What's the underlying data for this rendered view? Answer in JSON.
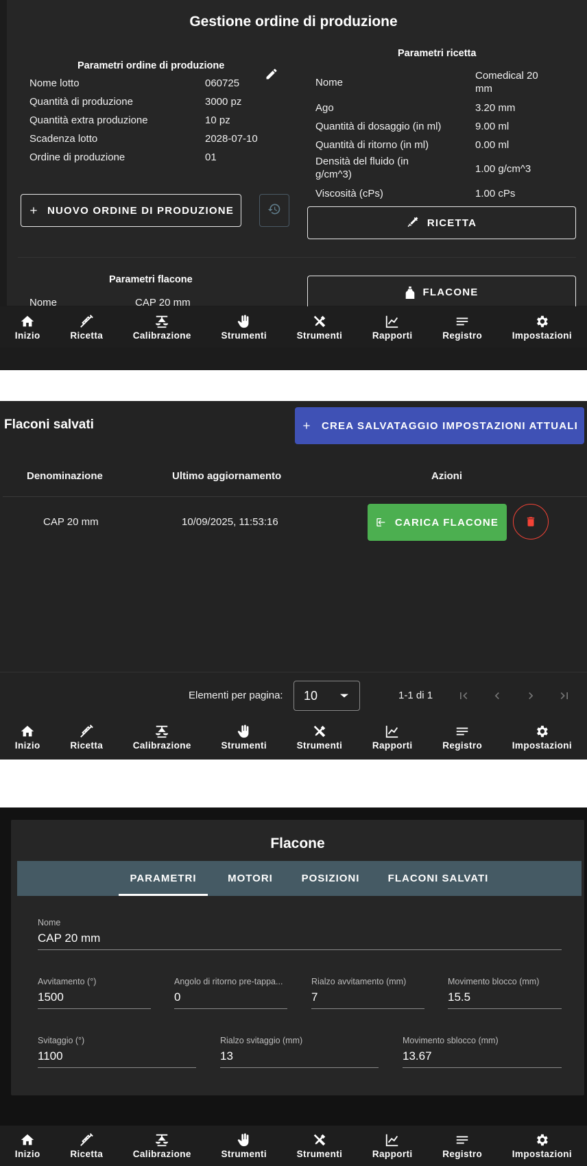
{
  "nav_items": [
    {
      "label": "Inizio",
      "icon": "home-icon"
    },
    {
      "label": "Ricetta",
      "icon": "syringe-icon"
    },
    {
      "label": "Calibrazione",
      "icon": "scale-icon"
    },
    {
      "label": "Strumenti",
      "icon": "hand-icon"
    },
    {
      "label": "Strumenti",
      "icon": "tools-icon"
    },
    {
      "label": "Rapporti",
      "icon": "chart-icon"
    },
    {
      "label": "Registro",
      "icon": "list-icon"
    },
    {
      "label": "Impostazioni",
      "icon": "gear-icon"
    }
  ],
  "panel1": {
    "title": "Gestione ordine di produzione",
    "order_params": {
      "title": "Parametri ordine di produzione",
      "rows": [
        {
          "label": "Nome lotto",
          "value": "060725"
        },
        {
          "label": "Quantità di produzione",
          "value": "3000 pz"
        },
        {
          "label": "Quantità extra produzione",
          "value": "10 pz"
        },
        {
          "label": "Scadenza lotto",
          "value": "2028-07-10"
        },
        {
          "label": "Ordine di produzione",
          "value": "01"
        }
      ]
    },
    "recipe_params": {
      "title": "Parametri ricetta",
      "rows": [
        {
          "label": "Nome",
          "value": "Comedical 20 mm"
        },
        {
          "label": "Ago",
          "value": "3.20 mm"
        },
        {
          "label": "Quantità di dosaggio (in ml)",
          "value": "9.00 ml"
        },
        {
          "label": "Quantità di ritorno (in ml)",
          "value": "0.00 ml"
        },
        {
          "label": "Densità del fluido (in g/cm^3)",
          "value": "1.00 g/cm^3"
        },
        {
          "label": "Viscosità (cPs)",
          "value": "1.00 cPs"
        }
      ]
    },
    "new_order_button": "NUOVO ORDINE DI PRODUZIONE",
    "recipe_button": "RICETTA",
    "bottle_params": {
      "title": "Parametri flacone",
      "rows": [
        {
          "label": "Nome",
          "value": "CAP 20 mm"
        }
      ]
    },
    "bottle_button": "FLACONE"
  },
  "panel2": {
    "title": "Flaconi salvati",
    "create_button": "CREA SALVATAGGIO IMPOSTAZIONI ATTUALI",
    "columns": [
      "Denominazione",
      "Ultimo aggiornamento",
      "Azioni"
    ],
    "rows": [
      {
        "name": "CAP 20 mm",
        "updated": "10/09/2025, 11:53:16",
        "load_label": "CARICA FLACONE"
      }
    ],
    "items_per_page_label": "Elementi per pagina:",
    "items_per_page": "10",
    "range": "1-1 di 1"
  },
  "panel3": {
    "title": "Flacone",
    "tabs": [
      "PARAMETRI",
      "MOTORI",
      "POSIZIONI",
      "FLACONI SALVATI"
    ],
    "active_tab": "PARAMETRI",
    "name_field": {
      "label": "Nome",
      "value": "CAP 20 mm"
    },
    "row1": [
      {
        "label": "Avvitamento (°)",
        "value": "1500"
      },
      {
        "label": "Angolo di ritorno pre-tappa...",
        "value": "0"
      },
      {
        "label": "Rialzo avvitamento (mm)",
        "value": "7"
      },
      {
        "label": "Movimento blocco (mm)",
        "value": "15.5"
      }
    ],
    "row2": [
      {
        "label": "Svitaggio (°)",
        "value": "1100"
      },
      {
        "label": "Rialzo svitaggio (mm)",
        "value": "13"
      },
      {
        "label": "Movimento sblocco (mm)",
        "value": "13.67"
      }
    ]
  },
  "colors": {
    "primary": "#3f51b5",
    "success": "#4caf50",
    "danger": "#f44336",
    "tabbar": "#455a64"
  }
}
